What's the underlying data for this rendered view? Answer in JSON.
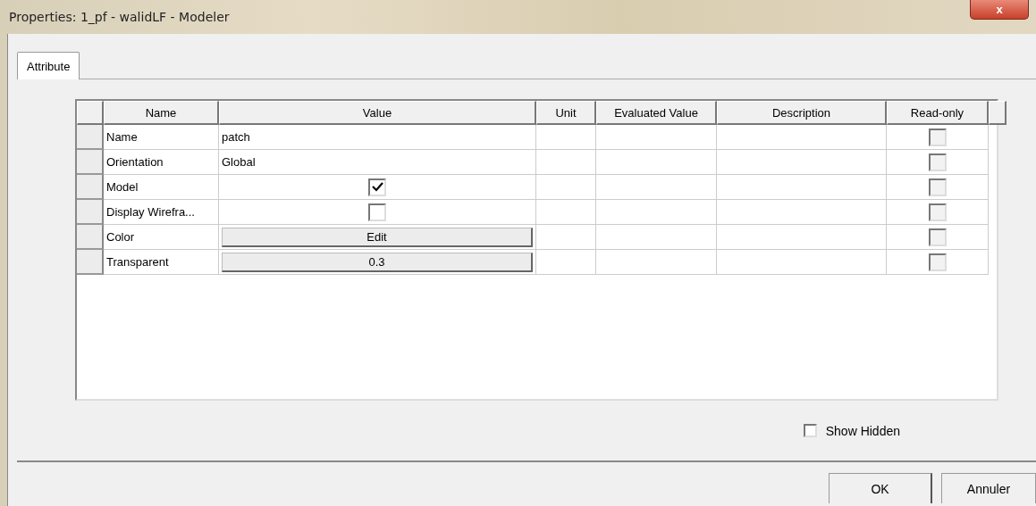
{
  "window": {
    "title": "Properties: 1_pf - walidLF - Modeler",
    "close": "x"
  },
  "tabs": [
    {
      "label": "Attribute",
      "selected": true
    }
  ],
  "table": {
    "columns": [
      "Name",
      "Value",
      "Unit",
      "Evaluated Value",
      "Description",
      "Read-only"
    ],
    "rows": [
      {
        "name": "Name",
        "kind": "text",
        "value": "patch",
        "read_only": false
      },
      {
        "name": "Orientation",
        "kind": "text",
        "value": "Global",
        "read_only": false
      },
      {
        "name": "Model",
        "kind": "checkbox",
        "checked": true,
        "read_only": false
      },
      {
        "name": "Display Wirefra...",
        "kind": "checkbox",
        "checked": false,
        "read_only": false
      },
      {
        "name": "Color",
        "kind": "button",
        "value": "Edit",
        "read_only": false
      },
      {
        "name": "Transparent",
        "kind": "button",
        "value": "0.3",
        "read_only": false
      }
    ]
  },
  "show_hidden": {
    "label": "Show Hidden",
    "checked": false
  },
  "buttons": [
    "OK",
    "Annuler"
  ]
}
